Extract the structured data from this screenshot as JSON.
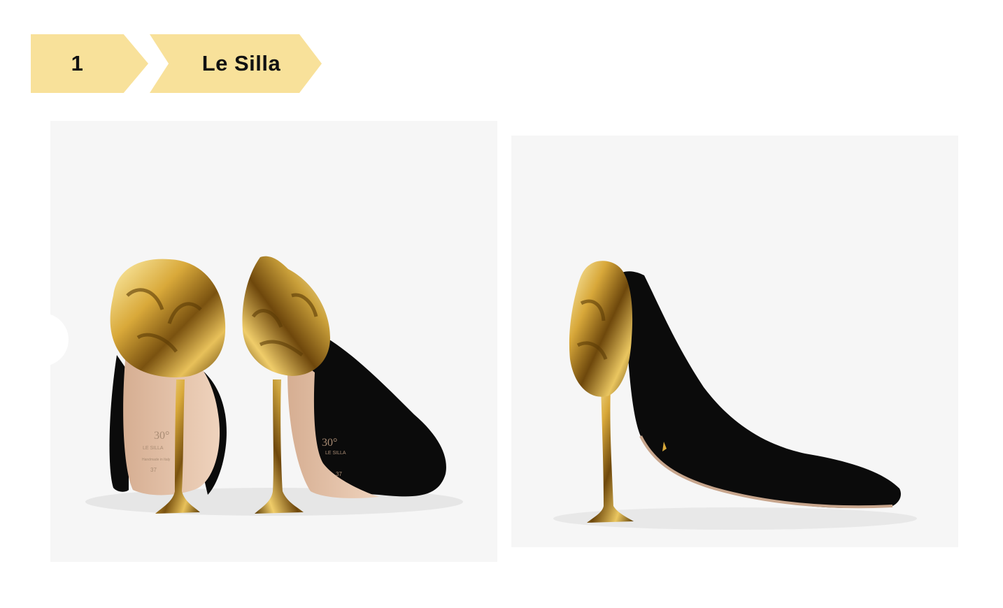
{
  "ranking": {
    "rank": "1",
    "brand": "Le Silla"
  },
  "colors": {
    "badge": "#f8e19a",
    "badge_text": "#111111",
    "photo_background": "#f6f6f6",
    "suede": "#0b0b0b",
    "gold": "#d9a93a",
    "lining": "#e5c1a6"
  },
  "images": [
    {
      "name": "shoe-pair-back-view",
      "insole_marks": [
        "30",
        "LE SILLA",
        "Handmade in Italy",
        "37"
      ]
    },
    {
      "name": "shoe-side-view"
    }
  ]
}
